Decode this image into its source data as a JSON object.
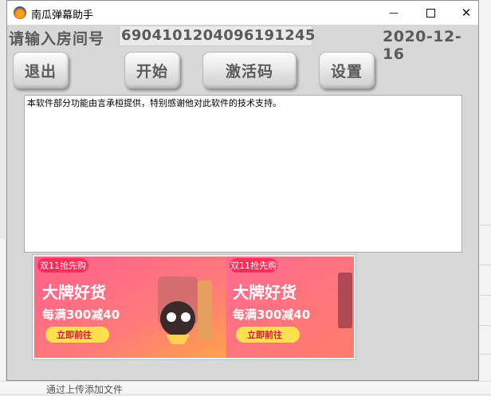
{
  "window": {
    "title": "南瓜弹幕助手",
    "controls": {
      "minimize": "—",
      "close": "✕"
    }
  },
  "room": {
    "label": "请输入房间号",
    "value": "6904101204096191245"
  },
  "date": "2020-12-16",
  "buttons": {
    "exit": "退出",
    "start": "开始",
    "activate": "激活码",
    "settings": "设置"
  },
  "notice_text": "本软件部分功能由言承桓提供，特别感谢他对此软件的技术支持。",
  "ad": {
    "badge": "双11抢先购",
    "headline": "大牌好货",
    "promo": "每满300减40",
    "cta": "立即前往"
  },
  "background": {
    "bottom_text": "通过上传添加文件"
  },
  "colors": {
    "window_bg": "#d8d8d8",
    "label_text": "#5a5a5a",
    "ad_pink": "#ff5a8a",
    "ad_orange": "#ff9a4a"
  }
}
